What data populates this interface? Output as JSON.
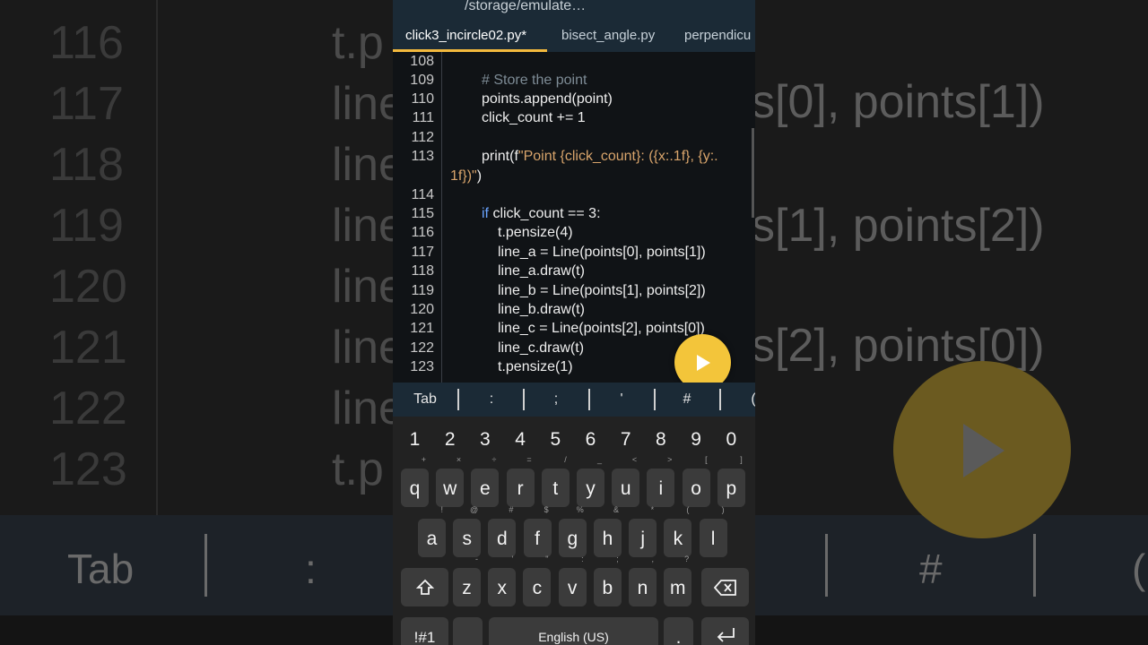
{
  "background": {
    "line_numbers": [
      "116",
      "117",
      "118",
      "119",
      "120",
      "121",
      "122",
      "123"
    ],
    "code_fragments": [
      "t.p",
      "line",
      "line",
      "line",
      "line",
      "line",
      "line",
      "t.p"
    ],
    "right_fragments": [
      "s[0], points[1])",
      "s[1], points[2])",
      "s[2], points[0])"
    ],
    "tab_labels": [
      "Tab",
      ":",
      "#",
      "("
    ]
  },
  "header": {
    "path": "/storage/emulate…"
  },
  "tabs": [
    {
      "label": "click3_incircle02.py*",
      "active": true
    },
    {
      "label": "bisect_angle.py",
      "active": false
    },
    {
      "label": "perpendicu",
      "active": false
    }
  ],
  "editor": {
    "line_numbers": [
      "108",
      "109",
      "110",
      "111",
      "112",
      "113",
      "114",
      "115",
      "116",
      "117",
      "118",
      "119",
      "120",
      "121",
      "122",
      "123"
    ],
    "lines": {
      "l109": "# Store the point",
      "l110": "points.append(point)",
      "l111": "click_count += 1",
      "l113_a": "print(f",
      "l113_b": "\"Point {click_count}: ({x:.1f}, {y:.",
      "l113_c": "1f})\"",
      "l113_d": ")",
      "l115_kw": "if",
      "l115_rest": " click_count == 3:",
      "l116": "t.pensize(4)",
      "l117": "line_a = Line(points[0], points[1])",
      "l118": "line_a.draw(t)",
      "l119": "line_b = Line(points[1], points[2])",
      "l120": "line_b.draw(t)",
      "l121": "line_c = Line(points[2], points[0])",
      "l122": "line_c.draw(t)",
      "l123": "t.pensize(1)"
    }
  },
  "run_button": {
    "icon": "play-icon",
    "color": "#f3c53a"
  },
  "symbol_bar": [
    "Tab",
    ":",
    ";",
    "'",
    "#",
    "("
  ],
  "keyboard": {
    "numbers": [
      "1",
      "2",
      "3",
      "4",
      "5",
      "6",
      "7",
      "8",
      "9",
      "0"
    ],
    "row1": [
      {
        "k": "q",
        "s": "+"
      },
      {
        "k": "w",
        "s": "×"
      },
      {
        "k": "e",
        "s": "÷"
      },
      {
        "k": "r",
        "s": "="
      },
      {
        "k": "t",
        "s": "/"
      },
      {
        "k": "y",
        "s": "_"
      },
      {
        "k": "u",
        "s": "<"
      },
      {
        "k": "i",
        "s": ">"
      },
      {
        "k": "o",
        "s": "["
      },
      {
        "k": "p",
        "s": "]"
      }
    ],
    "row2": [
      {
        "k": "a",
        "s": "!"
      },
      {
        "k": "s",
        "s": "@"
      },
      {
        "k": "d",
        "s": "#"
      },
      {
        "k": "f",
        "s": "$"
      },
      {
        "k": "g",
        "s": "%"
      },
      {
        "k": "h",
        "s": "&"
      },
      {
        "k": "j",
        "s": "*"
      },
      {
        "k": "k",
        "s": "("
      },
      {
        "k": "l",
        "s": ")"
      }
    ],
    "row3": [
      {
        "k": "z",
        "s": "-"
      },
      {
        "k": "x",
        "s": "'"
      },
      {
        "k": "c",
        "s": "\""
      },
      {
        "k": "v",
        "s": ":"
      },
      {
        "k": "b",
        "s": ";"
      },
      {
        "k": "n",
        "s": ","
      },
      {
        "k": "m",
        "s": "?"
      }
    ],
    "symbols_key": "!#1",
    "space_label": "English (US)",
    "period_key": "."
  }
}
